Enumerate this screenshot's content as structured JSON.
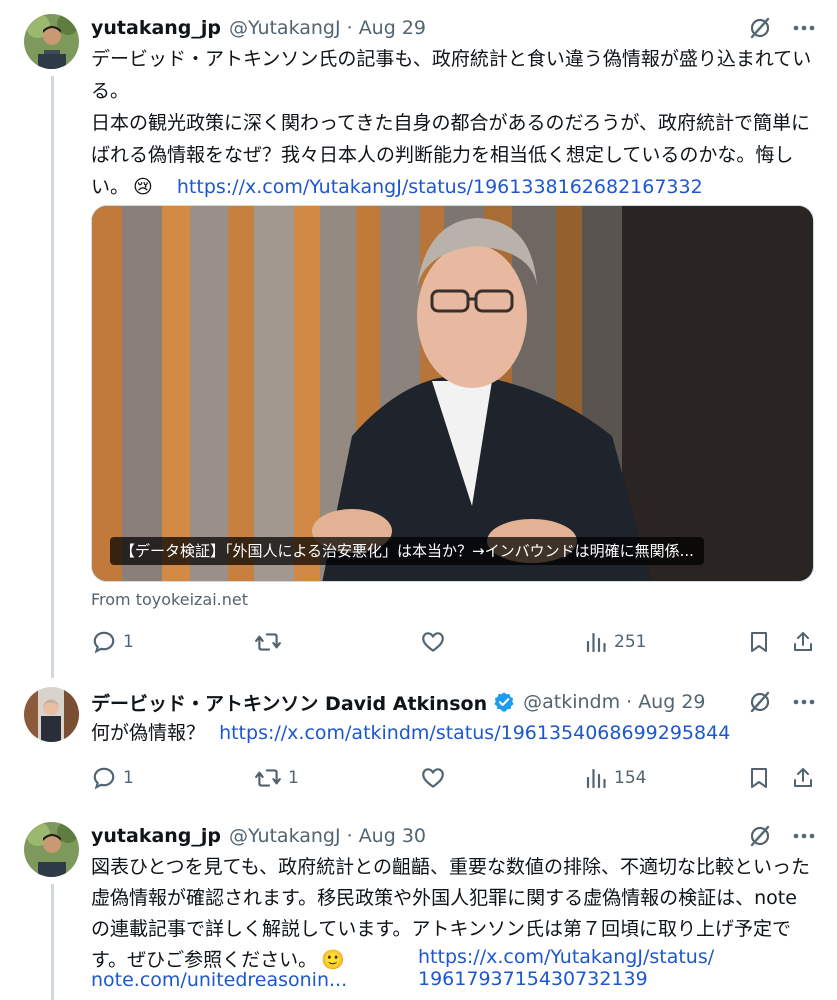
{
  "tweets": [
    {
      "name": "yutakang_jp",
      "handle": "@YutakangJ",
      "date": "· Aug 29",
      "text_main": "デービッド・アトキンソン氏の記事も、政府統計と食い違う偽情報が盛り込まれている。\n日本の観光政策に深く関わってきた自身の都合があるのだろうが、政府統計で簡単にばれる偽情報をなぜ？我々日本人の判断能力を相当低く想定しているのかな。悔しい。",
      "emoji": "😢",
      "link": "https://x.com/YutakangJ/status/1961338162682167332",
      "media_caption": "【データ検証】「外国人による治安悪化」は本当か？→インバウンドは明確に無関係...",
      "source": "From toyokeizai.net",
      "replies": "1",
      "retweets": "",
      "likes": "",
      "views": "251"
    },
    {
      "name": "デービッド・アトキンソン David Atkinson",
      "handle": "@atkindm",
      "date": "· Aug 29",
      "text_main": "何が偽情報？",
      "link": "https://x.com/atkindm/status/1961354068699295844",
      "replies": "1",
      "retweets": "1",
      "likes": "",
      "views": "154"
    },
    {
      "name": "yutakang_jp",
      "handle": "@YutakangJ",
      "date": "· Aug 30",
      "text_main": "図表ひとつを見ても、政府統計との齟齬、重要な数値の排除、不適切な比較といった虚偽情報が確認されます。移民政策や外国人犯罪に関する虚偽情報の検証は、noteの連載記事で詳しく解説しています。アトキンソン氏は第７回頃に取り上げ予定です。ぜひご参照ください。",
      "emoji": "🙂",
      "link_a": "note.com/unitedreasonin...",
      "link_b_1": "https://x.com/YutakangJ/status/",
      "link_b_2": "1961793715430732139"
    }
  ],
  "colors": {
    "link": "#1d57d0",
    "secondary": "#536471",
    "verified": "#1d9bf0",
    "thread_line": "#cfd9de"
  },
  "icons": [
    "grok-icon",
    "more-icon",
    "reply-icon",
    "retweet-icon",
    "like-icon",
    "views-icon",
    "bookmark-icon",
    "share-icon",
    "verified-badge-icon"
  ]
}
